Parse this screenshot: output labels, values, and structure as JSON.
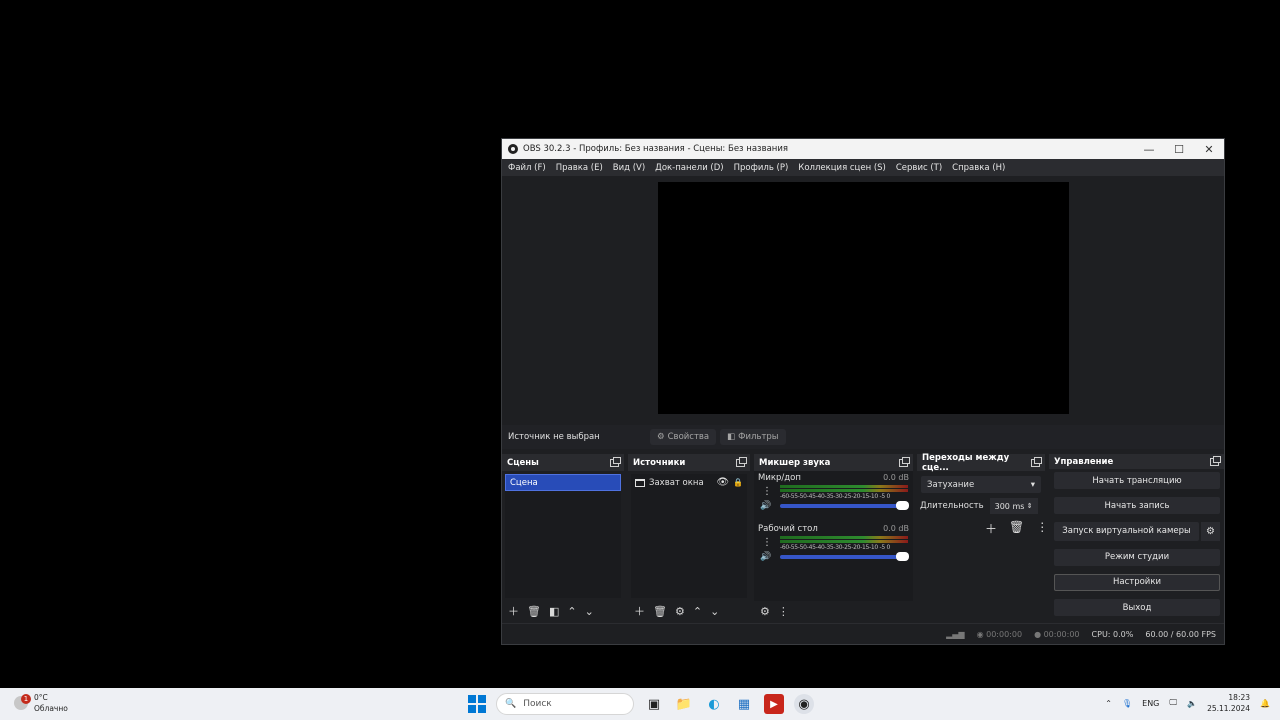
{
  "window": {
    "title": "OBS 30.2.3 - Профиль: Без названия - Сцены: Без названия",
    "controls": [
      "—",
      "☐",
      "✕"
    ]
  },
  "menu": [
    "Файл (F)",
    "Правка (E)",
    "Вид (V)",
    "Док-панели (D)",
    "Профиль (P)",
    "Коллекция сцен (S)",
    "Сервис (T)",
    "Справка (H)"
  ],
  "source_bar": {
    "no_source": "Источник не выбран",
    "properties": "Свойства",
    "filters": "Фильтры"
  },
  "docks": {
    "scenes": {
      "title": "Сцены",
      "items": [
        "Сцена"
      ]
    },
    "sources": {
      "title": "Источники",
      "items": [
        "Захват окна"
      ]
    },
    "mixer": {
      "title": "Микшер звука",
      "channels": [
        {
          "name": "Микр/доп",
          "db": "0.0 dB",
          "scale": "-60-55-50-45-40-35-30-25-20-15-10 -5 0"
        },
        {
          "name": "Рабочий стол",
          "db": "0.0 dB",
          "scale": "-60-55-50-45-40-35-30-25-20-15-10 -5 0"
        }
      ]
    },
    "transitions": {
      "title": "Переходы между сце...",
      "selected": "Затухание",
      "duration_label": "Длительность",
      "duration_value": "300 ms"
    },
    "controls": {
      "title": "Управление",
      "start_stream": "Начать трансляцию",
      "start_record": "Начать запись",
      "virtual_cam": "Запуск виртуальной камеры",
      "studio_mode": "Режим студии",
      "settings": "Настройки",
      "exit": "Выход"
    }
  },
  "status": {
    "stream_time": "00:00:00",
    "record_time": "00:00:00",
    "cpu": "CPU: 0.0%",
    "fps": "60.00 / 60.00 FPS"
  },
  "taskbar": {
    "weather_temp": "0°C",
    "weather_desc": "Облачно",
    "weather_badge": "1",
    "search_placeholder": "Поиск",
    "lang": "ENG",
    "time": "18:23",
    "date": "25.11.2024"
  },
  "colors": {
    "accent": "#284cb8",
    "fader": "#3656c8",
    "windows_blue": "#0078d4"
  }
}
